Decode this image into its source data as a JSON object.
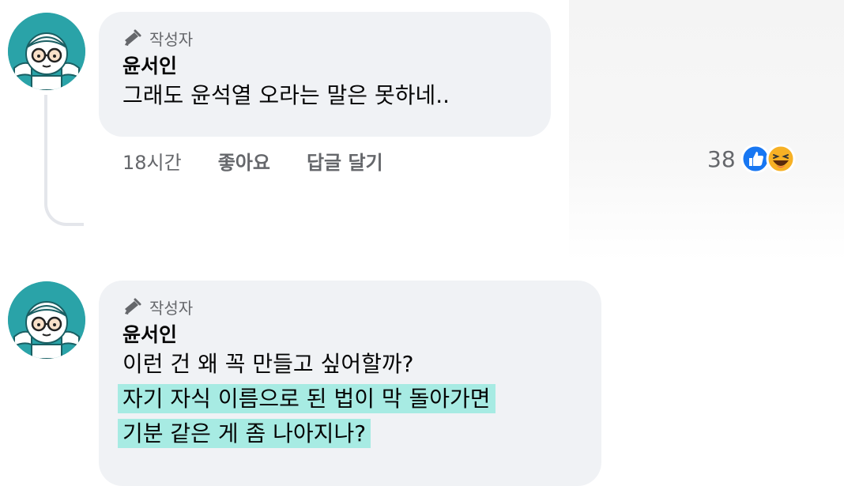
{
  "comments": [
    {
      "badge": "작성자",
      "name": "윤서인",
      "lines": [
        "그래도 윤석열 오라는 말은 못하네.."
      ],
      "time": "18시간",
      "like": "좋아요",
      "reply": "답글 달기",
      "reaction_count": "38",
      "reactions": [
        "like-icon",
        "haha-icon"
      ]
    },
    {
      "badge": "작성자",
      "name": "윤서인",
      "lines": [
        "이런 건 왜 꼭 만들고 싶어할까?",
        "자기 자식 이름으로 된 법이 막 돌아가면",
        "기분 같은 게 좀 나아지나?"
      ],
      "highlighted_lines": [
        1,
        2
      ]
    }
  ],
  "colors": {
    "avatar_bg": "#2aa3a8",
    "bubble_bg": "#f0f2f5",
    "highlight": "#a7ebe3",
    "meta_text": "#65676b",
    "like_blue": "#1877f2",
    "haha_yellow": "#f7b125"
  }
}
